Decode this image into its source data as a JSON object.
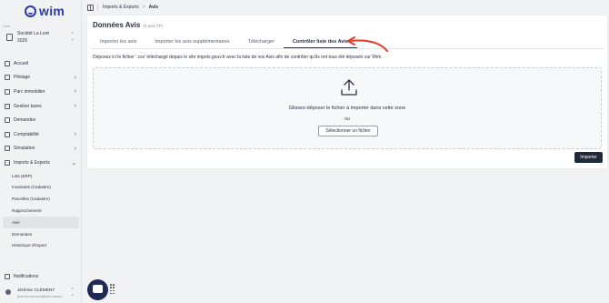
{
  "app": {
    "logo_text": "wim",
    "brand_color": "#2f3a9e"
  },
  "org": {
    "label": "Loré",
    "name": "Société La Loré",
    "year": "2025"
  },
  "nav": [
    {
      "label": "Accueil",
      "icon": "home-icon",
      "chevron": false
    },
    {
      "label": "Pilotage",
      "icon": "chart-icon",
      "chevron": true
    },
    {
      "label": "Parc immobilier",
      "icon": "building-icon",
      "chevron": true
    },
    {
      "label": "Gestion taxes",
      "icon": "tax-icon",
      "chevron": true
    },
    {
      "label": "Demandes",
      "icon": "inbox-icon",
      "chevron": false
    },
    {
      "label": "Comptabilité",
      "icon": "ledger-icon",
      "chevron": true
    },
    {
      "label": "Simulation",
      "icon": "calculator-icon",
      "chevron": true
    },
    {
      "label": "Imports & Exports",
      "icon": "folder-icon",
      "chevron": true,
      "expanded": true
    }
  ],
  "subnav": [
    {
      "label": "Lots (ERP)"
    },
    {
      "label": "Invariants (Cadastre)"
    },
    {
      "label": "Parcelles (Cadastre)"
    },
    {
      "label": "Rapprochement"
    },
    {
      "label": "Avis",
      "active": true
    },
    {
      "label": "Demandes"
    },
    {
      "label": "Historique d'import"
    }
  ],
  "notifications": {
    "label": "Notifications"
  },
  "user": {
    "name": "Jérémie CLÉMENT",
    "email": "jeremie.clement@wim-financ..."
  },
  "breadcrumb": {
    "parent": "Imports & Exports",
    "separator": ">",
    "current": "Avis"
  },
  "page": {
    "title": "Données Avis",
    "subtitle": "(0 avis TF)",
    "tabs": [
      {
        "label": "Importer les avis",
        "active": false
      },
      {
        "label": "Importer les avis supplémentaires",
        "active": false
      },
      {
        "label": "Télécharger",
        "active": false
      },
      {
        "label": "Contrôler liste des Avis",
        "active": true
      }
    ],
    "description": "Déposez ici le fichier '.csv' téléchargé depuis le site impots.gouv.fr avec la liste de vos Avis afin de contrôler qu'ils ont tous été déposés sur Wim.",
    "dropzone": {
      "text": "Glissez-déposer le fichier à importer dans cette zone",
      "or": "ou",
      "select_button": "Sélectionner un fichier"
    },
    "import_button": "Importer"
  },
  "colors": {
    "annotation_arrow": "#e23b2c",
    "primary_button": "#1f2937",
    "help_bubble": "#1f2a55"
  }
}
